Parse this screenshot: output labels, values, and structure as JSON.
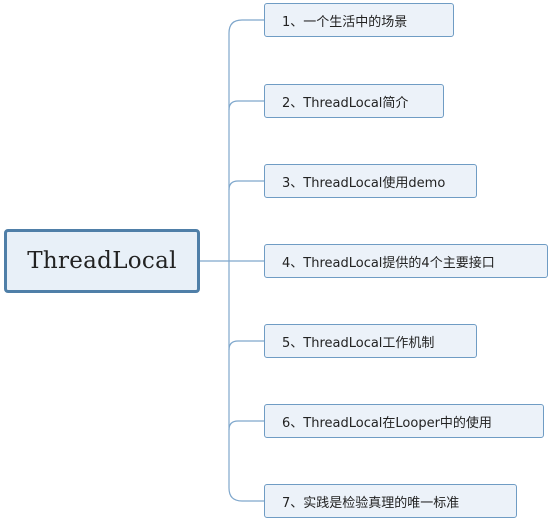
{
  "root": {
    "label": "ThreadLocal"
  },
  "branches": [
    {
      "label": "1、一个生活中的场景"
    },
    {
      "label": "2、ThreadLocal简介"
    },
    {
      "label": "3、ThreadLocal使用demo"
    },
    {
      "label": "4、ThreadLocal提供的4个主要接口"
    },
    {
      "label": "5、ThreadLocal工作机制"
    },
    {
      "label": "6、ThreadLocal在Looper中的使用"
    },
    {
      "label": "7、实践是检验真理的唯一标准"
    }
  ],
  "colors": {
    "root_border": "#4f7fa8",
    "root_fill": "#e8f0f8",
    "branch_border": "#6f9cc4",
    "branch_fill": "#ecf2f9",
    "connector": "#7fa7cc"
  }
}
